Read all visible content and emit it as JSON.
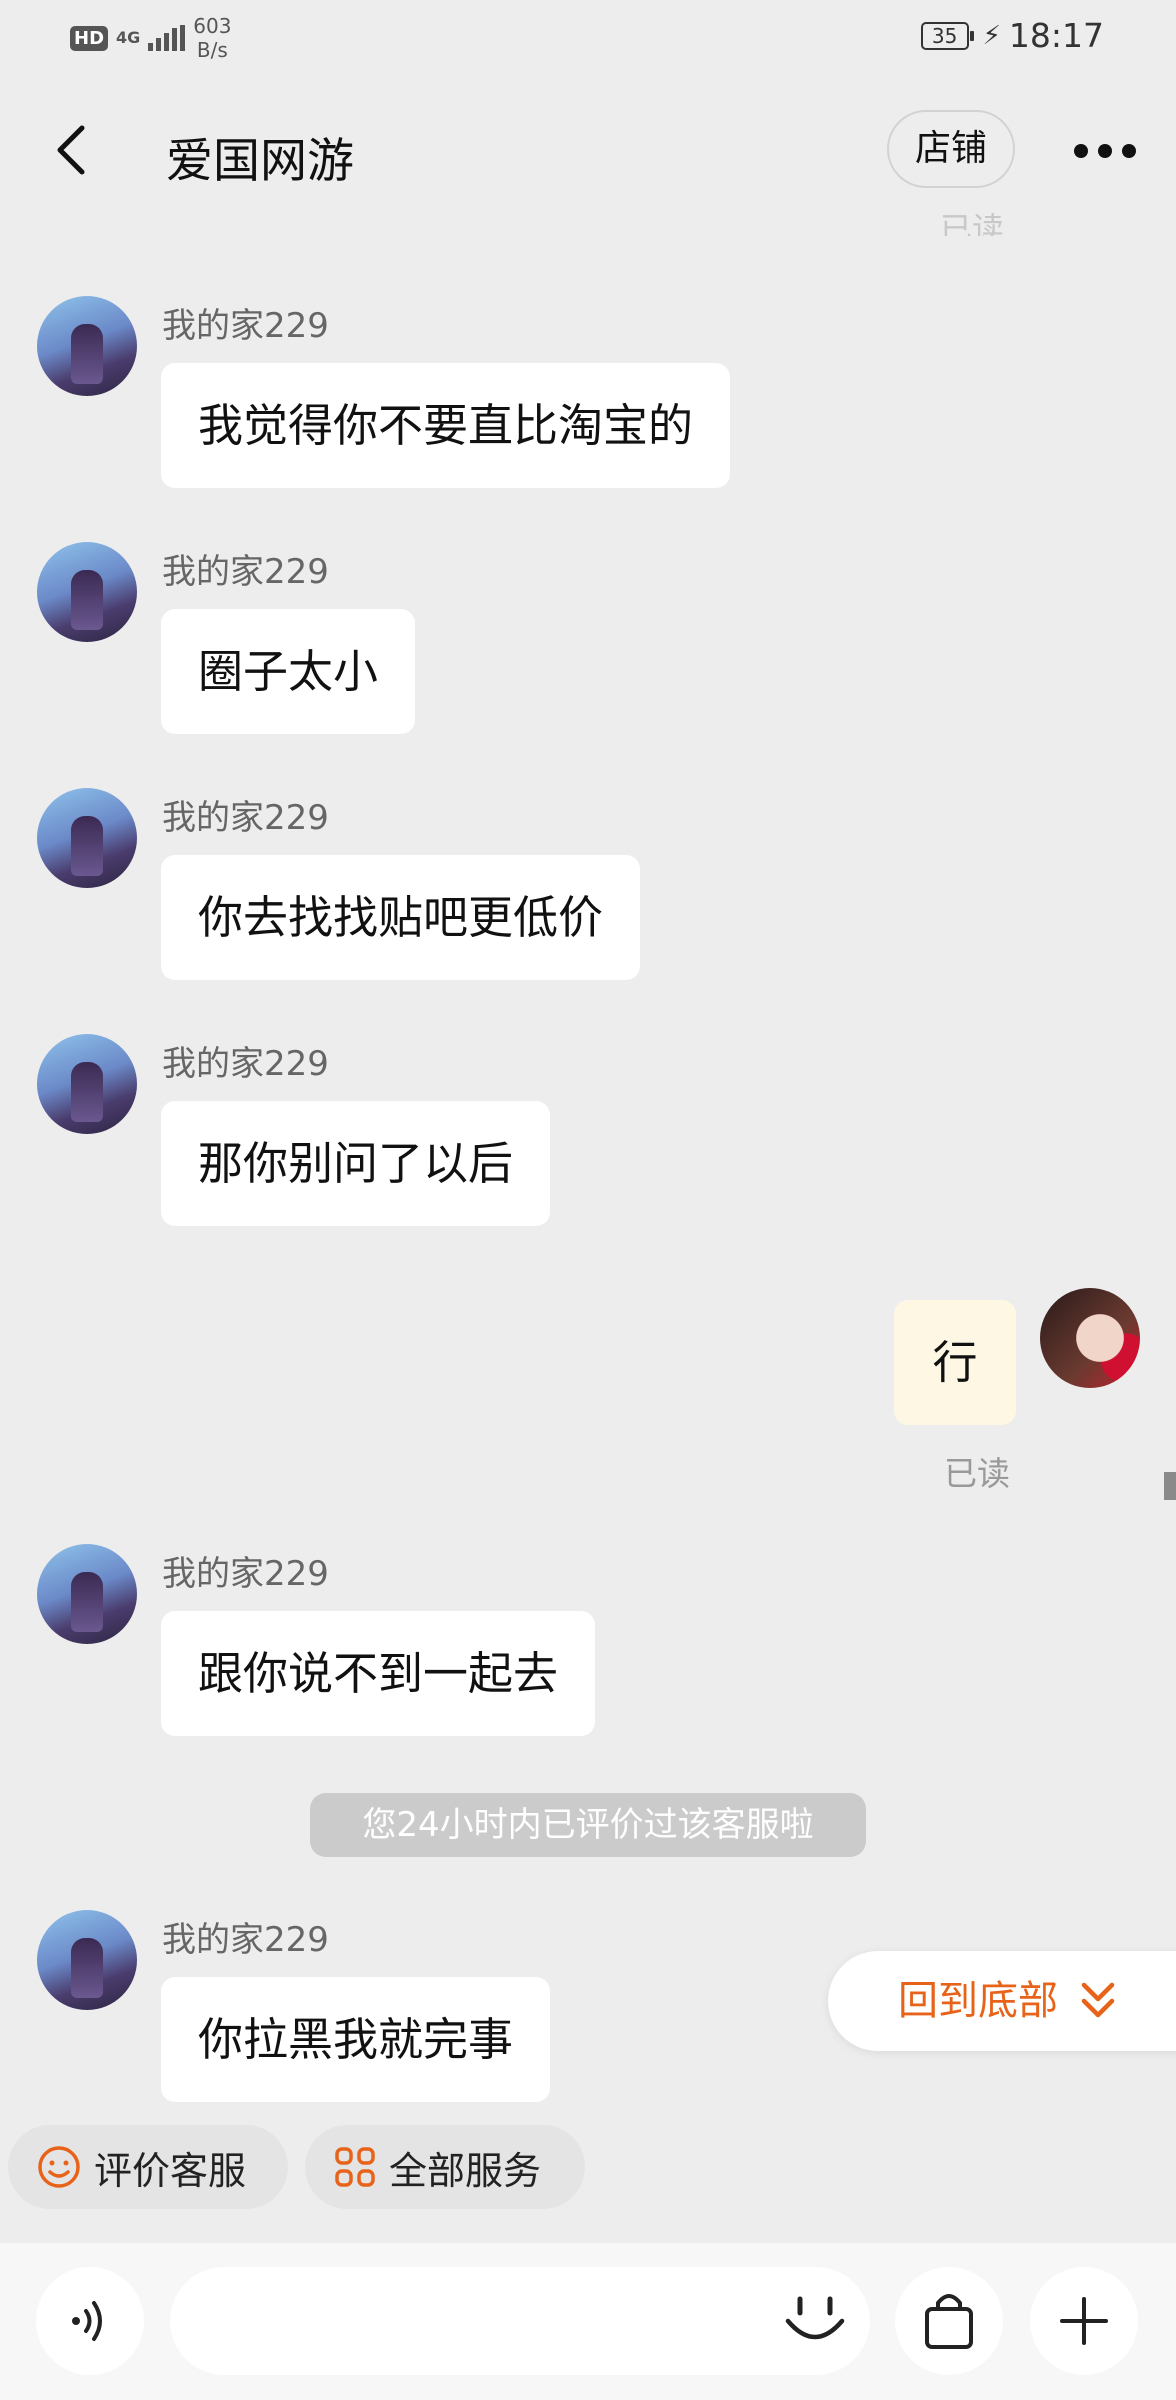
{
  "status_bar": {
    "hd": "HD",
    "network": "4G",
    "speed_value": "603",
    "speed_unit": "B/s",
    "battery": "35",
    "time": "18:17"
  },
  "header": {
    "title": "爱国网游",
    "shop_button": "店铺"
  },
  "top_read_label": "已读",
  "messages": [
    {
      "sender": "我的家229",
      "text": "我觉得你不要直比淘宝的"
    },
    {
      "sender": "我的家229",
      "text": "圈子太小"
    },
    {
      "sender": "我的家229",
      "text": "你去找找贴吧更低价"
    },
    {
      "sender": "我的家229",
      "text": "那你别问了以后"
    },
    {
      "sender": "self",
      "text": "行",
      "read_label": "已读"
    },
    {
      "sender": "我的家229",
      "text": "跟你说不到一起去"
    },
    {
      "sender": "我的家229",
      "text": "你拉黑我就完事"
    }
  ],
  "system_notice": "您24小时内已评价过该客服啦",
  "back_to_bottom": "回到底部",
  "quick_actions": [
    {
      "label": "评价客服",
      "icon": "smiley-icon"
    },
    {
      "label": "全部服务",
      "icon": "grid-icon"
    }
  ],
  "input": {
    "placeholder": ""
  },
  "colors": {
    "accent": "#E8631A",
    "background": "#EDEDED",
    "self_bubble": "#FDF7E3"
  }
}
